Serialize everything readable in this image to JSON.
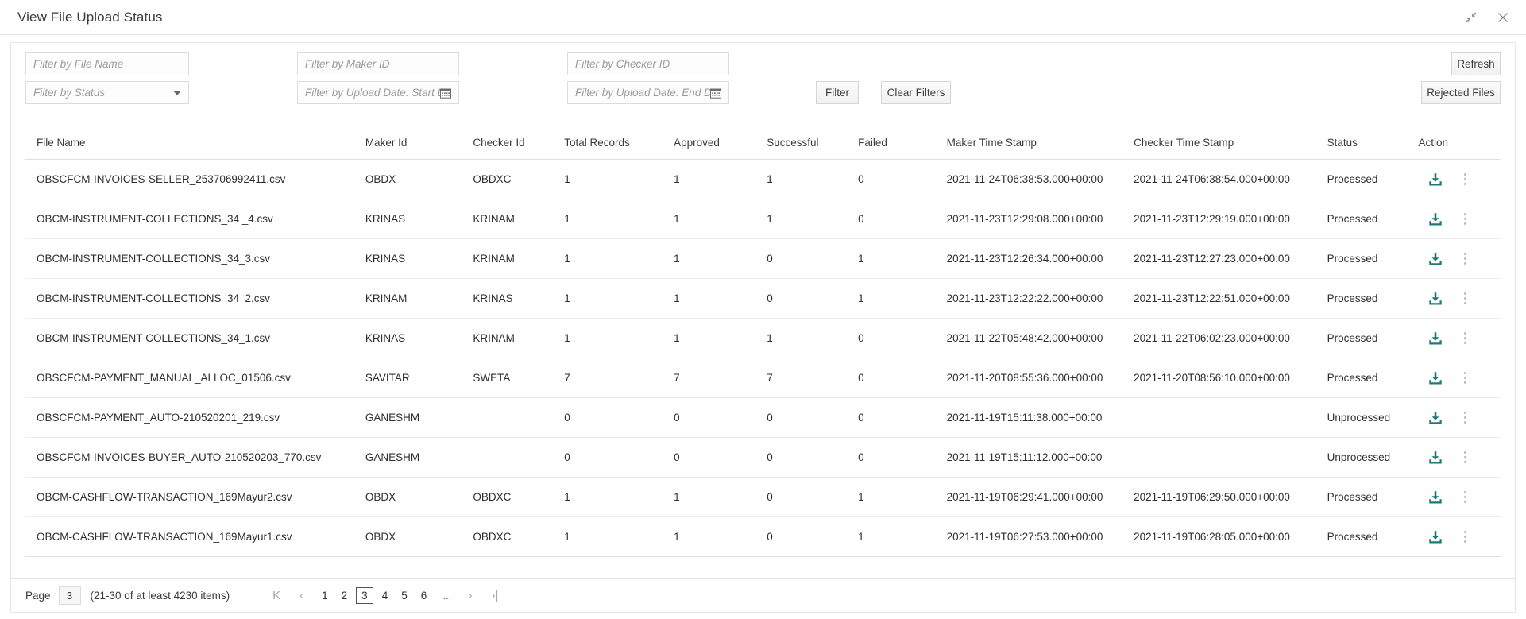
{
  "window": {
    "title": "View File Upload Status",
    "controls": [
      {
        "name": "collapse-icon",
        "label": "Collapse"
      },
      {
        "name": "close-icon",
        "label": "Close"
      }
    ]
  },
  "filters": {
    "file_name_placeholder": "Filter by File Name",
    "status_placeholder": "Filter by Status",
    "maker_id_placeholder": "Filter by Maker ID",
    "start_date_placeholder": "Filter by Upload Date: Start Date",
    "checker_id_placeholder": "Filter by Checker ID",
    "end_date_placeholder": "Filter by Upload Date: End Date",
    "file_name_value": "",
    "status_value": "",
    "maker_id_value": "",
    "start_date_value": "",
    "checker_id_value": "",
    "end_date_value": "",
    "buttons": {
      "filter": "Filter",
      "clear_filters": "Clear Filters",
      "refresh": "Refresh",
      "rejected_files": "Rejected Files"
    }
  },
  "table": {
    "columns": [
      "File Name",
      "Maker Id",
      "Checker Id",
      "Total Records",
      "Approved",
      "Successful",
      "Failed",
      "Maker Time Stamp",
      "Checker Time Stamp",
      "Status",
      "Action"
    ],
    "rows": [
      {
        "file_name": "OBSCFCM-INVOICES-SELLER_253706992411.csv",
        "maker_id": "OBDX",
        "checker_id": "OBDXC",
        "total_records": "1",
        "approved": "1",
        "successful": "1",
        "failed": "0",
        "maker_time_stamp": "2021-11-24T06:38:53.000+00:00",
        "checker_time_stamp": "2021-11-24T06:38:54.000+00:00",
        "status": "Processed"
      },
      {
        "file_name": "OBCM-INSTRUMENT-COLLECTIONS_34 _4.csv",
        "maker_id": "KRINAS",
        "checker_id": "KRINAM",
        "total_records": "1",
        "approved": "1",
        "successful": "1",
        "failed": "0",
        "maker_time_stamp": "2021-11-23T12:29:08.000+00:00",
        "checker_time_stamp": "2021-11-23T12:29:19.000+00:00",
        "status": "Processed"
      },
      {
        "file_name": "OBCM-INSTRUMENT-COLLECTIONS_34_3.csv",
        "maker_id": "KRINAS",
        "checker_id": "KRINAM",
        "total_records": "1",
        "approved": "1",
        "successful": "0",
        "failed": "1",
        "maker_time_stamp": "2021-11-23T12:26:34.000+00:00",
        "checker_time_stamp": "2021-11-23T12:27:23.000+00:00",
        "status": "Processed"
      },
      {
        "file_name": "OBCM-INSTRUMENT-COLLECTIONS_34_2.csv",
        "maker_id": "KRINAM",
        "checker_id": "KRINAS",
        "total_records": "1",
        "approved": "1",
        "successful": "0",
        "failed": "1",
        "maker_time_stamp": "2021-11-23T12:22:22.000+00:00",
        "checker_time_stamp": "2021-11-23T12:22:51.000+00:00",
        "status": "Processed"
      },
      {
        "file_name": "OBCM-INSTRUMENT-COLLECTIONS_34_1.csv",
        "maker_id": "KRINAS",
        "checker_id": "KRINAM",
        "total_records": "1",
        "approved": "1",
        "successful": "1",
        "failed": "0",
        "maker_time_stamp": "2021-11-22T05:48:42.000+00:00",
        "checker_time_stamp": "2021-11-22T06:02:23.000+00:00",
        "status": "Processed"
      },
      {
        "file_name": "OBSCFCM-PAYMENT_MANUAL_ALLOC_01506.csv",
        "maker_id": "SAVITAR",
        "checker_id": "SWETA",
        "total_records": "7",
        "approved": "7",
        "successful": "7",
        "failed": "0",
        "maker_time_stamp": "2021-11-20T08:55:36.000+00:00",
        "checker_time_stamp": "2021-11-20T08:56:10.000+00:00",
        "status": "Processed"
      },
      {
        "file_name": "OBSCFCM-PAYMENT_AUTO-210520201_219.csv",
        "maker_id": "GANESHM",
        "checker_id": "",
        "total_records": "0",
        "approved": "0",
        "successful": "0",
        "failed": "0",
        "maker_time_stamp": "2021-11-19T15:11:38.000+00:00",
        "checker_time_stamp": "",
        "status": "Unprocessed"
      },
      {
        "file_name": "OBSCFCM-INVOICES-BUYER_AUTO-210520203_770.csv",
        "maker_id": "GANESHM",
        "checker_id": "",
        "total_records": "0",
        "approved": "0",
        "successful": "0",
        "failed": "0",
        "maker_time_stamp": "2021-11-19T15:11:12.000+00:00",
        "checker_time_stamp": "",
        "status": "Unprocessed"
      },
      {
        "file_name": "OBCM-CASHFLOW-TRANSACTION_169Mayur2.csv",
        "maker_id": "OBDX",
        "checker_id": "OBDXC",
        "total_records": "1",
        "approved": "1",
        "successful": "0",
        "failed": "1",
        "maker_time_stamp": "2021-11-19T06:29:41.000+00:00",
        "checker_time_stamp": "2021-11-19T06:29:50.000+00:00",
        "status": "Processed"
      },
      {
        "file_name": "OBCM-CASHFLOW-TRANSACTION_169Mayur1.csv",
        "maker_id": "OBDX",
        "checker_id": "OBDXC",
        "total_records": "1",
        "approved": "1",
        "successful": "0",
        "failed": "1",
        "maker_time_stamp": "2021-11-19T06:27:53.000+00:00",
        "checker_time_stamp": "2021-11-19T06:28:05.000+00:00",
        "status": "Processed"
      }
    ],
    "row_action_icons": [
      "download-icon",
      "more-options-icon"
    ]
  },
  "pagination": {
    "page_label": "Page",
    "page_value": "3",
    "range_text": "(21-30 of at least 4230 items)",
    "first_label": "K",
    "prev_label": "‹",
    "next_label": "›",
    "last_label": "›|",
    "pages": [
      "1",
      "2",
      "3",
      "4",
      "5",
      "6"
    ],
    "ellipsis": "...",
    "current_page": "3"
  },
  "colors": {
    "accent_teal": "#1a7a74",
    "border": "#e3e3e3",
    "text": "#2f2f2f",
    "placeholder": "#9a9a9a"
  }
}
